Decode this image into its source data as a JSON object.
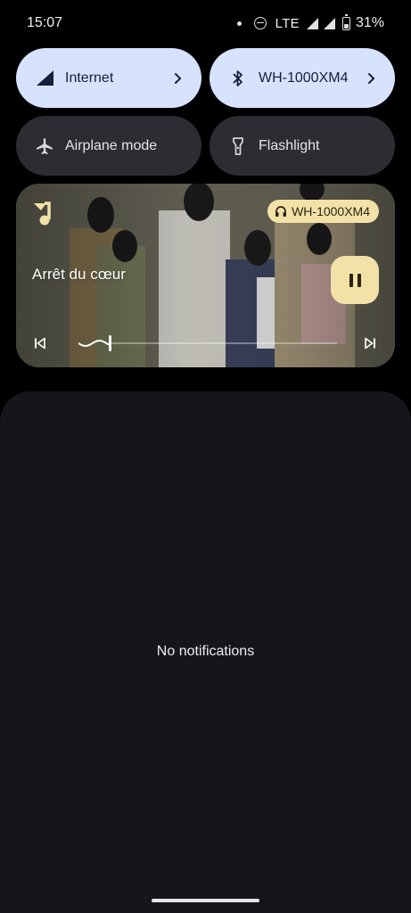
{
  "status_bar": {
    "time": "15:07",
    "network": "LTE",
    "battery": "31%",
    "battery_level": 0.31,
    "icons": [
      "notification-dot-icon",
      "do-not-disturb-icon",
      "lte-signal-icon",
      "cell-signal-icon",
      "battery-icon"
    ]
  },
  "tiles": [
    {
      "label": "Internet",
      "icon": "cellular-signal-icon",
      "state": "on",
      "has_chevron": true
    },
    {
      "label": "WH-1000XM4",
      "icon": "bluetooth-icon",
      "state": "on",
      "has_chevron": true
    },
    {
      "label": "Airplane mode",
      "icon": "airplane-icon",
      "state": "off",
      "has_chevron": false
    },
    {
      "label": "Flashlight",
      "icon": "flashlight-icon",
      "state": "off",
      "has_chevron": false
    }
  ],
  "media": {
    "title": "Arrêt du cœur",
    "output_device": "WH-1000XM4",
    "app_icon": "music-note-icon",
    "playback_state": "playing",
    "progress": 0.12,
    "controls": [
      "previous-icon",
      "pause-icon",
      "next-icon"
    ]
  },
  "notifications": {
    "empty_text": "No notifications"
  },
  "colors": {
    "tile_on": "#d7e2ff",
    "tile_off": "#2b2d33",
    "media_accent": "#f3e2a7",
    "shade_background": "#14161b"
  }
}
